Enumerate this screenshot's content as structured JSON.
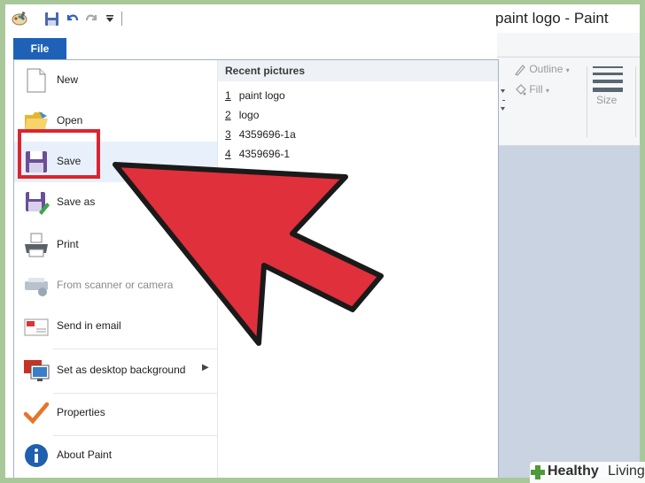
{
  "window": {
    "title": "paint logo - Paint"
  },
  "file_tab": {
    "label": "File"
  },
  "file_menu": {
    "items": [
      {
        "label": "New",
        "icon": "new-document-icon"
      },
      {
        "label": "Open",
        "icon": "open-folder-icon"
      },
      {
        "label": "Save",
        "icon": "save-disk-icon"
      },
      {
        "label": "Save as",
        "icon": "save-as-icon"
      },
      {
        "label": "Print",
        "icon": "printer-icon"
      },
      {
        "label": "From scanner or camera",
        "icon": "scanner-icon",
        "disabled": true
      },
      {
        "label": "Send in email",
        "icon": "email-icon"
      },
      {
        "label": "Set as desktop background",
        "icon": "desktop-background-icon",
        "has_submenu": true
      },
      {
        "label": "Properties",
        "icon": "checkmark-icon"
      },
      {
        "label": "About Paint",
        "icon": "info-icon"
      }
    ]
  },
  "recent": {
    "header": "Recent pictures",
    "items": [
      {
        "num": "1",
        "name": "paint logo"
      },
      {
        "num": "2",
        "name": "logo"
      },
      {
        "num": "3",
        "name": "4359696-1a"
      },
      {
        "num": "4",
        "name": "4359696-1"
      }
    ]
  },
  "ribbon": {
    "outline_label": "Outline",
    "fill_label": "Fill",
    "size_label": "Size"
  },
  "watermark": {
    "brand": "Healthy",
    "brand2": "Living"
  },
  "colors": {
    "file_tab": "#1e62b8",
    "highlight_red": "#dc2430",
    "arrow_red": "#e0303c",
    "border_green": "#a9c89a"
  }
}
